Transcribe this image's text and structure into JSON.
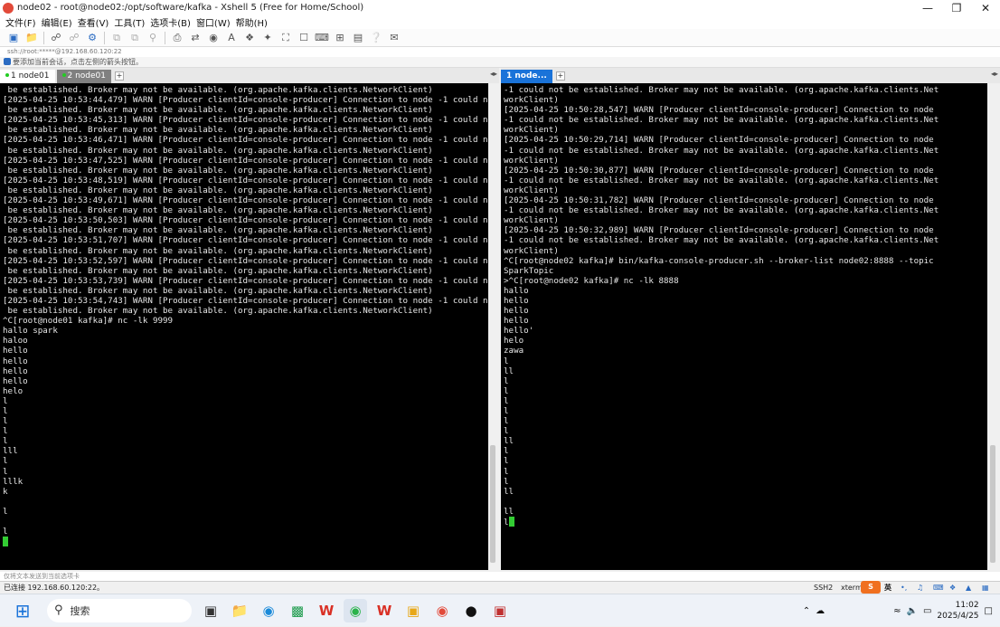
{
  "window": {
    "title": "node02 - root@node02:/opt/software/kafka - Xshell 5 (Free for Home/School)"
  },
  "menu": [
    "文件(F)",
    "编辑(E)",
    "查看(V)",
    "工具(T)",
    "选项卡(B)",
    "窗口(W)",
    "帮助(H)"
  ],
  "address": "ssh://root:*****@192.168.60.120:22",
  "hint": "要添加当前会话，点击左侧的箭头按钮。",
  "left_tabs": [
    {
      "label": "1 node01"
    },
    {
      "label": "2 node01"
    }
  ],
  "right_tabs": [
    {
      "label": "1 node..."
    }
  ],
  "left_terminal": [
    " be established. Broker may not be available. (org.apache.kafka.clients.NetworkClient)",
    "[2025-04-25 10:53:44,479] WARN [Producer clientId=console-producer] Connection to node -1 could not",
    " be established. Broker may not be available. (org.apache.kafka.clients.NetworkClient)",
    "[2025-04-25 10:53:45,313] WARN [Producer clientId=console-producer] Connection to node -1 could not",
    " be established. Broker may not be available. (org.apache.kafka.clients.NetworkClient)",
    "[2025-04-25 10:53:46,471] WARN [Producer clientId=console-producer] Connection to node -1 could not",
    " be established. Broker may not be available. (org.apache.kafka.clients.NetworkClient)",
    "[2025-04-25 10:53:47,525] WARN [Producer clientId=console-producer] Connection to node -1 could not",
    " be established. Broker may not be available. (org.apache.kafka.clients.NetworkClient)",
    "[2025-04-25 10:53:48,519] WARN [Producer clientId=console-producer] Connection to node -1 could not",
    " be established. Broker may not be available. (org.apache.kafka.clients.NetworkClient)",
    "[2025-04-25 10:53:49,671] WARN [Producer clientId=console-producer] Connection to node -1 could not",
    " be established. Broker may not be available. (org.apache.kafka.clients.NetworkClient)",
    "[2025-04-25 10:53:50,503] WARN [Producer clientId=console-producer] Connection to node -1 could not",
    " be established. Broker may not be available. (org.apache.kafka.clients.NetworkClient)",
    "[2025-04-25 10:53:51,707] WARN [Producer clientId=console-producer] Connection to node -1 could not",
    " be established. Broker may not be available. (org.apache.kafka.clients.NetworkClient)",
    "[2025-04-25 10:53:52,597] WARN [Producer clientId=console-producer] Connection to node -1 could not",
    " be established. Broker may not be available. (org.apache.kafka.clients.NetworkClient)",
    "[2025-04-25 10:53:53,739] WARN [Producer clientId=console-producer] Connection to node -1 could not",
    " be established. Broker may not be available. (org.apache.kafka.clients.NetworkClient)",
    "[2025-04-25 10:53:54,743] WARN [Producer clientId=console-producer] Connection to node -1 could not",
    " be established. Broker may not be available. (org.apache.kafka.clients.NetworkClient)",
    "^C[root@node01 kafka]# nc -lk 9999",
    "hallo spark",
    "haloo",
    "hello",
    "hello",
    "hello",
    "hello",
    "helo",
    "l",
    "l",
    "l",
    "l",
    "l",
    "lll",
    "l",
    "l",
    "lllk",
    "k",
    "",
    "l",
    "",
    "l"
  ],
  "right_terminal": [
    "-1 could not be established. Broker may not be available. (org.apache.kafka.clients.Net",
    "workClient)",
    "[2025-04-25 10:50:28,547] WARN [Producer clientId=console-producer] Connection to node",
    "-1 could not be established. Broker may not be available. (org.apache.kafka.clients.Net",
    "workClient)",
    "[2025-04-25 10:50:29,714] WARN [Producer clientId=console-producer] Connection to node",
    "-1 could not be established. Broker may not be available. (org.apache.kafka.clients.Net",
    "workClient)",
    "[2025-04-25 10:50:30,877] WARN [Producer clientId=console-producer] Connection to node",
    "-1 could not be established. Broker may not be available. (org.apache.kafka.clients.Net",
    "workClient)",
    "[2025-04-25 10:50:31,782] WARN [Producer clientId=console-producer] Connection to node",
    "-1 could not be established. Broker may not be available. (org.apache.kafka.clients.Net",
    "workClient)",
    "[2025-04-25 10:50:32,989] WARN [Producer clientId=console-producer] Connection to node",
    "-1 could not be established. Broker may not be available. (org.apache.kafka.clients.Net",
    "workClient)",
    "^C[root@node02 kafka]# bin/kafka-console-producer.sh --broker-list node02:8888 --topic",
    "SparkTopic",
    ">^C[root@node02 kafka]# nc -lk 8888",
    "hallo",
    "hello",
    "hello",
    "hello",
    "hello'",
    "helo",
    "zawa",
    "l",
    "ll",
    "l",
    "l",
    "l",
    "l",
    "l",
    "l",
    "ll",
    "l",
    "l",
    "l",
    "l",
    "ll",
    "",
    "ll"
  ],
  "right_prompt_prefix": "l",
  "send_hint": "仅将文本发送到当前选项卡",
  "status": {
    "connection": "已连接 192.168.60.120:22。",
    "protocol": "SSH2",
    "term": "xterm"
  },
  "taskbar": {
    "search_placeholder": "搜索",
    "time": "11:02",
    "date": "2025/4/25",
    "ime": "英"
  }
}
